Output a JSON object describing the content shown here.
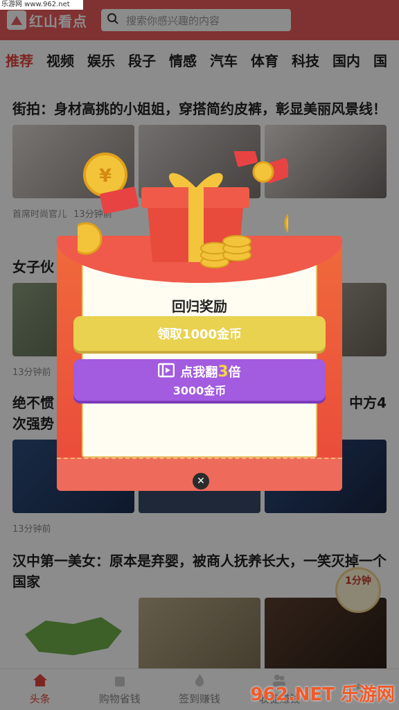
{
  "watermark_top": "乐游网 www.962.net",
  "header": {
    "app_name": "红山看点",
    "search_placeholder": "搜索你感兴趣的内容"
  },
  "tabs": [
    {
      "label": "推荐",
      "active": true
    },
    {
      "label": "视频"
    },
    {
      "label": "娱乐"
    },
    {
      "label": "段子"
    },
    {
      "label": "情感"
    },
    {
      "label": "汽车"
    },
    {
      "label": "体育"
    },
    {
      "label": "科技"
    },
    {
      "label": "国内"
    },
    {
      "label": "国"
    }
  ],
  "articles": [
    {
      "title": "街拍：身材高挑的小姐姐，穿搭简约皮裤，彰显美丽风景线！",
      "source": "首席时尚官儿",
      "time": "13分钟前"
    },
    {
      "title": "女子伙",
      "time": "13分钟前"
    },
    {
      "title": "绝不惯 次强势",
      "title_right": "中方4",
      "time": "13分钟前"
    },
    {
      "title": "汉中第一美女：原本是弃婴，被商人抚养长大，一笑灭掉一个国家"
    }
  ],
  "modal": {
    "title": "回归奖励",
    "claim_button": "领取1000金币",
    "triple_prefix": "点我翻",
    "triple_number": "3",
    "triple_suffix": "倍",
    "triple_sub": "3000金币",
    "close_symbol": "✕"
  },
  "float_badge": "1分钟",
  "bottom_nav": [
    {
      "label": "头条",
      "active": true
    },
    {
      "label": "购物省钱"
    },
    {
      "label": "签到赚钱"
    },
    {
      "label": "收徒赚钱"
    },
    {
      "label": ""
    }
  ],
  "corner_watermark": "962.NET 乐游网",
  "colors": {
    "brand_red": "#e95b5b",
    "active_tab": "#e2453d",
    "claim_yellow": "#e8d250",
    "triple_purple": "#a35be0"
  }
}
